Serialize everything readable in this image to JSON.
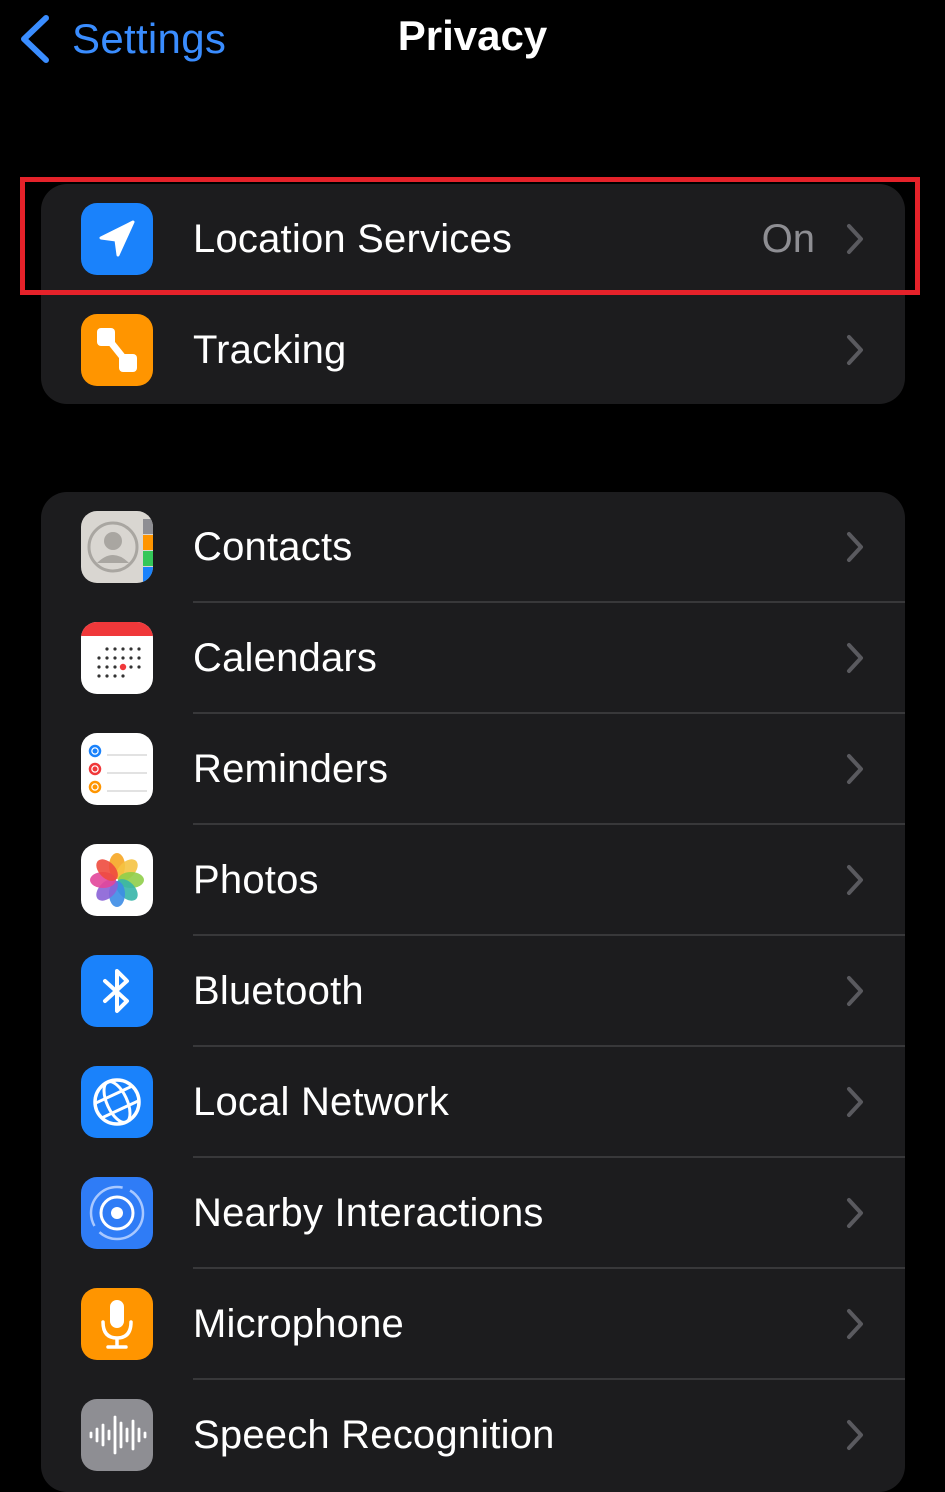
{
  "nav": {
    "back_label": "Settings",
    "title": "Privacy",
    "accent_color": "#3a8dff"
  },
  "groups": [
    {
      "rows": [
        {
          "label": "Location Services",
          "value": "On",
          "icon": "location-arrow-icon",
          "icon_color": "#1a82fb"
        },
        {
          "label": "Tracking",
          "icon": "tracking-icon",
          "icon_color": "#ff9500"
        }
      ]
    },
    {
      "rows": [
        {
          "label": "Contacts",
          "icon": "contacts-icon",
          "icon_color": "#d9d6d1"
        },
        {
          "label": "Calendars",
          "icon": "calendar-icon",
          "icon_color": "#ffffff"
        },
        {
          "label": "Reminders",
          "icon": "reminders-icon",
          "icon_color": "#ffffff"
        },
        {
          "label": "Photos",
          "icon": "photos-icon",
          "icon_color": "#ffffff"
        },
        {
          "label": "Bluetooth",
          "icon": "bluetooth-icon",
          "icon_color": "#1a82fb"
        },
        {
          "label": "Local Network",
          "icon": "globe-icon",
          "icon_color": "#1a82fb"
        },
        {
          "label": "Nearby Interactions",
          "icon": "nearby-interactions-icon",
          "icon_color": "#2f7cf6"
        },
        {
          "label": "Microphone",
          "icon": "microphone-icon",
          "icon_color": "#ff9500"
        },
        {
          "label": "Speech Recognition",
          "icon": "waveform-icon",
          "icon_color": "#8e8e93"
        }
      ]
    }
  ],
  "highlight_color": "#e5222a"
}
